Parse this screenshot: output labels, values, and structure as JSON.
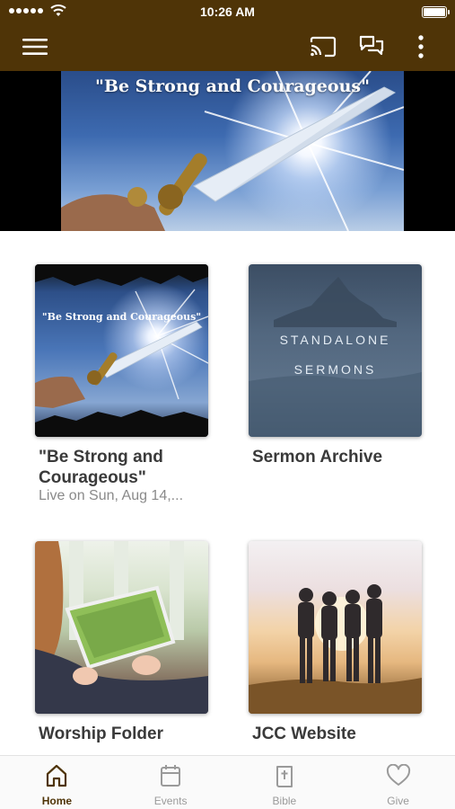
{
  "status_bar": {
    "time": "10:26 AM"
  },
  "toolbar": {
    "menu_icon": "hamburger-menu-icon",
    "cast_icon": "cast-icon",
    "chat_icon": "chat-bubbles-icon",
    "more_icon": "more-vertical-icon"
  },
  "banner": {
    "title": "\"Be Strong and Courageous\""
  },
  "cards": [
    {
      "title": "\"Be Strong and Courageous\"",
      "subtitle": "Live on Sun, Aug 14,...",
      "thumb_text": "\"Be Strong and Courageous\""
    },
    {
      "title": "Sermon Archive",
      "thumb_line1": "STANDALONE",
      "thumb_line2": "SERMONS"
    },
    {
      "title": "Worship Folder"
    },
    {
      "title": "JCC Website"
    }
  ],
  "tabbar": {
    "tabs": [
      {
        "label": "Home",
        "icon": "home-icon",
        "active": true
      },
      {
        "label": "Events",
        "icon": "calendar-icon",
        "active": false
      },
      {
        "label": "Bible",
        "icon": "bible-icon",
        "active": false
      },
      {
        "label": "Give",
        "icon": "heart-icon",
        "active": false
      }
    ]
  },
  "colors": {
    "brand": "#4f3407",
    "tab_inactive": "#9a9a9a",
    "title_text": "#3a3a3a",
    "subtitle_text": "#8a8a8a"
  }
}
